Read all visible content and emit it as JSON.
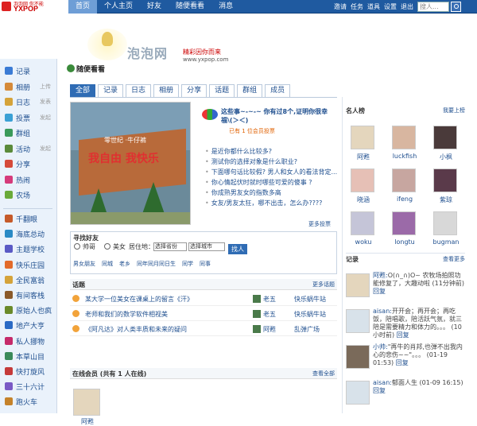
{
  "logo": {
    "line1": "泡泡网 你不能",
    "line2": "YXPOP"
  },
  "nav": [
    "首页",
    "个人主页",
    "好友",
    "随便看看",
    "消息"
  ],
  "nav_active": 0,
  "toplinks": [
    "邀请",
    "任务",
    "道具",
    "设置",
    "退出"
  ],
  "search": {
    "placeholder": "搜人..."
  },
  "banner": {
    "brand": "泡泡网",
    "slogan": "精彩因你而来",
    "url": "www.yxpop.com"
  },
  "sidebar": {
    "items": [
      {
        "label": "记录",
        "extra": "",
        "color": "#3a7bd5"
      },
      {
        "label": "相册",
        "extra": "上传",
        "color": "#d58a3a"
      },
      {
        "label": "日志",
        "extra": "发表",
        "color": "#d5a33a"
      },
      {
        "label": "投票",
        "extra": "发起",
        "color": "#3aa0d5"
      },
      {
        "label": "群组",
        "extra": "",
        "color": "#3a9a5a"
      },
      {
        "label": "活动",
        "extra": "发起",
        "color": "#5a8a3a"
      },
      {
        "label": "分享",
        "extra": "",
        "color": "#d54a3a"
      },
      {
        "label": "热闹",
        "extra": "",
        "color": "#d53a7b"
      },
      {
        "label": "农场",
        "extra": "",
        "color": "#6aaa3a"
      }
    ],
    "games": [
      {
        "label": "千翻眼",
        "color": "#c55a2a"
      },
      {
        "label": "海底总动",
        "color": "#2a8ac5"
      },
      {
        "label": "主题学校",
        "color": "#5a5ac5"
      },
      {
        "label": "快乐庄园",
        "color": "#e26a2a"
      },
      {
        "label": "全民富翁",
        "color": "#d5a33a"
      },
      {
        "label": "有间客栈",
        "color": "#8a5a2a"
      },
      {
        "label": "原始人也疯",
        "color": "#6a8a2a"
      },
      {
        "label": "地产大亨",
        "color": "#2a6ac5"
      },
      {
        "label": "私人挪物",
        "color": "#c52a6a"
      },
      {
        "label": "本草山目",
        "color": "#3a8a5a"
      },
      {
        "label": "快打旋风",
        "color": "#c53a3a"
      },
      {
        "label": "三十六计",
        "color": "#7a5ac5"
      },
      {
        "label": "跑火车",
        "color": "#c5822a"
      }
    ]
  },
  "page": {
    "title": "随便看看"
  },
  "tabs": [
    "全部",
    "记录",
    "日志",
    "相册",
    "分享",
    "话题",
    "群组",
    "成员"
  ],
  "photo": {
    "caption": "零世纪 ·牛仔裤",
    "bigtext": "我自由 我快乐"
  },
  "poll": {
    "title": "这些事~-~-~ 你有过8个,证明你很幸福\\(＞＜)",
    "sub": "已有 1 位会员投票",
    "items": [
      "是近你都什么比较多?",
      "测试你的选择对象是什么职业?",
      "下面哪句话比较假? 男人和女人的看法背定...",
      "你心情起伏时就时哪些可爱的傻事 ?",
      "你成熟男友女的指数多高",
      "女友/男友太狂，哪不出击，怎么办????"
    ],
    "more": "更多投票"
  },
  "find": {
    "title": "寻找好友",
    "opt1": "帅哥",
    "opt2": "美女",
    "live": "居住地：",
    "province": "选择省份",
    "city": "选择城市",
    "button": "找人",
    "links": [
      "男女朋友",
      "同城",
      "老乡",
      "同年同月同日生",
      "同学",
      "同事"
    ]
  },
  "topics": {
    "header": "话题",
    "more": "更多话题",
    "rows": [
      {
        "title": "某大学一位美女在课桌上的留言《汗》",
        "author": "老五",
        "group": "快乐蜗牛站"
      },
      {
        "title": "老师和我们的数学软件相视美",
        "author": "老五",
        "group": "快乐蜗牛站"
      },
      {
        "title": "《阿凡达》对人类丰质和未来的疑问",
        "author": "阿甦",
        "group": "乱弹广场"
      }
    ]
  },
  "online": {
    "header": "在线会员 (共有 1 人在线)",
    "more": "查看全部",
    "members": [
      "阿甦"
    ]
  },
  "celebs": {
    "header": "名人榜",
    "more": "我要上榜",
    "people": [
      {
        "name": "阿甦",
        "color": "#e4d6bd"
      },
      {
        "name": "luckfish",
        "color": "#d8b6a0"
      },
      {
        "name": "小枫",
        "color": "#4a3a3a"
      },
      {
        "name": "晓涵",
        "color": "#e6c0b6"
      },
      {
        "name": "ifeng",
        "color": "#c7a6a0"
      },
      {
        "name": "紫琼",
        "color": "#5a3a4a"
      },
      {
        "name": "woku",
        "color": "#c5c5d8"
      },
      {
        "name": "longtu",
        "color": "#9b6aa8"
      },
      {
        "name": "bugman",
        "color": "#d8d8d8"
      }
    ]
  },
  "records": {
    "header": "记录",
    "more": "查看更多",
    "items": [
      {
        "user": "阿甦:",
        "text": "O(∩_∩)O~ 农牧场拍照功能修复了，大趣动啦",
        "time": "(11分钟前)",
        "reply": "回复",
        "color": "#e4d6bd"
      },
      {
        "user": "aisan:",
        "text": "开开会；再开会；再吃饭，陪唱歌，陪活跃气氛，就三陪是需要精力和体力的。。。",
        "time": "(10小时前)",
        "reply": "回复",
        "color": "#d8e2ea"
      },
      {
        "user": "小帅:",
        "text": "\"再牛的肖邦,也弹不出我内心的悲伤~~\"。。。",
        "time": "(01-19 01:53)",
        "reply": "回复",
        "color": "#7a6a5a"
      },
      {
        "user": "aisan:",
        "text": "郁面人生",
        "time": "(01-09 16:15)",
        "reply": "回复",
        "color": "#d8e2ea"
      }
    ]
  }
}
